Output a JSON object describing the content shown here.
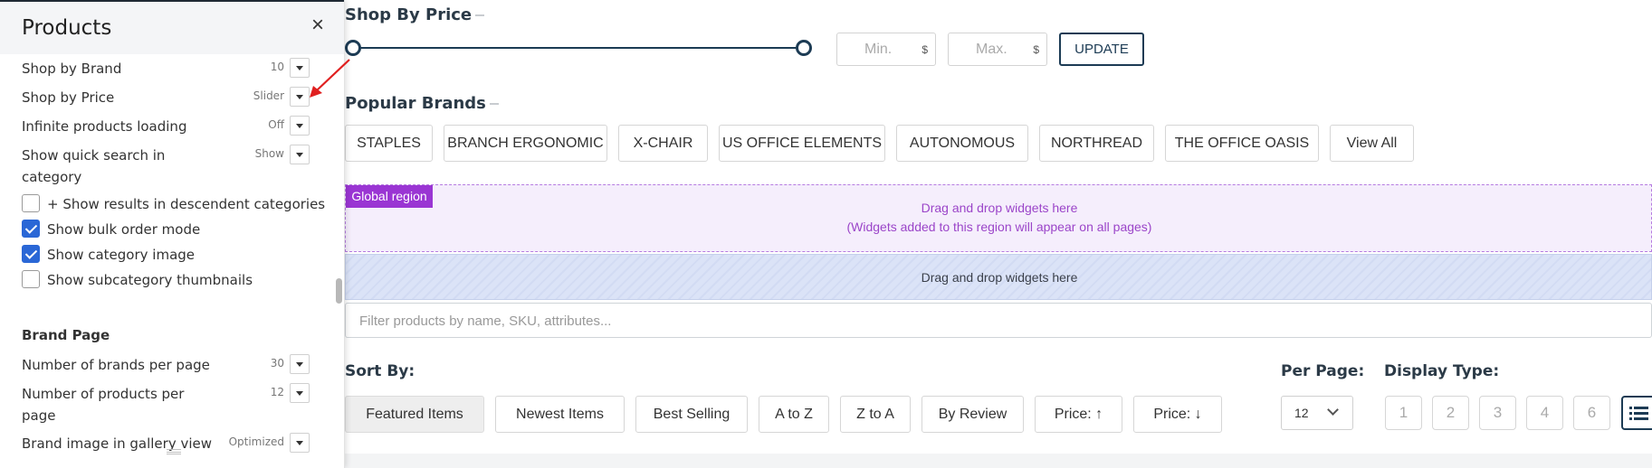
{
  "panel": {
    "title": "Products",
    "close_symbol": "×",
    "rows": [
      {
        "label": "Shop by Brand",
        "value": "10"
      },
      {
        "label": "Shop by Price",
        "value": "Slider"
      },
      {
        "label": "Infinite products loading",
        "value": "Off"
      },
      {
        "label": "Show quick search in category",
        "value": "Show"
      }
    ],
    "checkboxes": [
      {
        "label": "+ Show results in descendent categories",
        "checked": false
      },
      {
        "label": "Show bulk order mode",
        "checked": true
      },
      {
        "label": "Show category image",
        "checked": true
      },
      {
        "label": "Show subcategory thumbnails",
        "checked": false
      }
    ],
    "brand_page": {
      "heading": "Brand Page",
      "rows": [
        {
          "label": "Number of brands per page",
          "value": "30"
        },
        {
          "label": "Number of products per page",
          "value": "12"
        },
        {
          "label": "Brand image in gallery view",
          "value": "Optimized"
        }
      ]
    }
  },
  "shop_by_price": {
    "title": "Shop By Price",
    "min_placeholder": "Min.",
    "max_placeholder": "Max.",
    "currency": "$",
    "update_label": "UPDATE"
  },
  "popular_brands": {
    "title": "Popular Brands",
    "brands": [
      "STAPLES",
      "BRANCH ERGONOMIC",
      "X-CHAIR",
      "US OFFICE ELEMENTS",
      "AUTONOMOUS",
      "NORTHREAD",
      "THE OFFICE OASIS",
      "View All"
    ]
  },
  "global_region": {
    "tag": "Global region",
    "line1": "Drag and drop widgets here",
    "line2": "(Widgets added to this region will appear on all pages)"
  },
  "dnd_region": {
    "text": "Drag and drop widgets here"
  },
  "filter": {
    "placeholder": "Filter products by name, SKU, attributes..."
  },
  "sort": {
    "label": "Sort By:",
    "options": [
      "Featured Items",
      "Newest Items",
      "Best Selling",
      "A to Z",
      "Z to A",
      "By Review",
      "Price: ↑",
      "Price: ↓"
    ],
    "active_index": 0
  },
  "per_page": {
    "label": "Per Page:",
    "value": "12"
  },
  "display_type": {
    "label": "Display Type:",
    "options": [
      "1",
      "2",
      "3",
      "4",
      "6"
    ]
  },
  "colors": {
    "accent_navy": "#1c3b54",
    "checkbox_blue": "#2a67d6",
    "global_purple": "#9a35d3",
    "arrow_red": "#e02020"
  }
}
